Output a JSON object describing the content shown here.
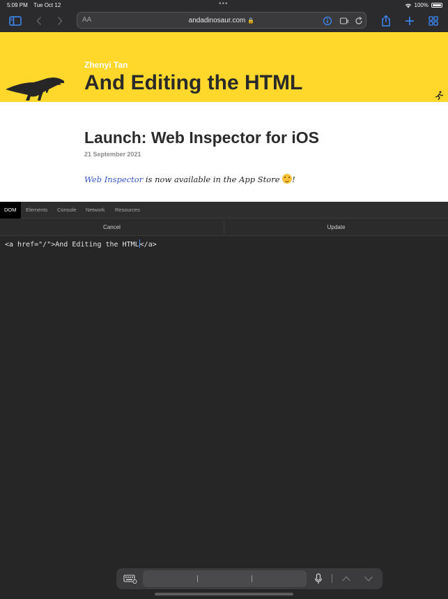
{
  "status_bar": {
    "time": "5:09 PM",
    "date": "Tue Oct 12",
    "battery": "100%"
  },
  "browser": {
    "reader_label": "AA",
    "url": "andadinosaur.com"
  },
  "site": {
    "author": "Zhenyi Tan",
    "title": "And Editing the HTML",
    "post_title": "Launch: Web Inspector for iOS",
    "post_date": "21 September 2021",
    "body_link": "Web Inspector",
    "body_text": " is now available in the App Store ",
    "body_end": "!"
  },
  "inspector": {
    "tabs": [
      {
        "label": "DOM"
      },
      {
        "label": "Elements"
      },
      {
        "label": "Console"
      },
      {
        "label": "Network"
      },
      {
        "label": "Resources"
      }
    ],
    "cancel_label": "Cancel",
    "update_label": "Update",
    "code_before_caret": "<a href=\"/\">And Editing the HTML",
    "code_after_caret": "</a>"
  },
  "colors": {
    "banner": "#ffd82b",
    "accent": "#3c8cff",
    "link": "#3556c4"
  }
}
